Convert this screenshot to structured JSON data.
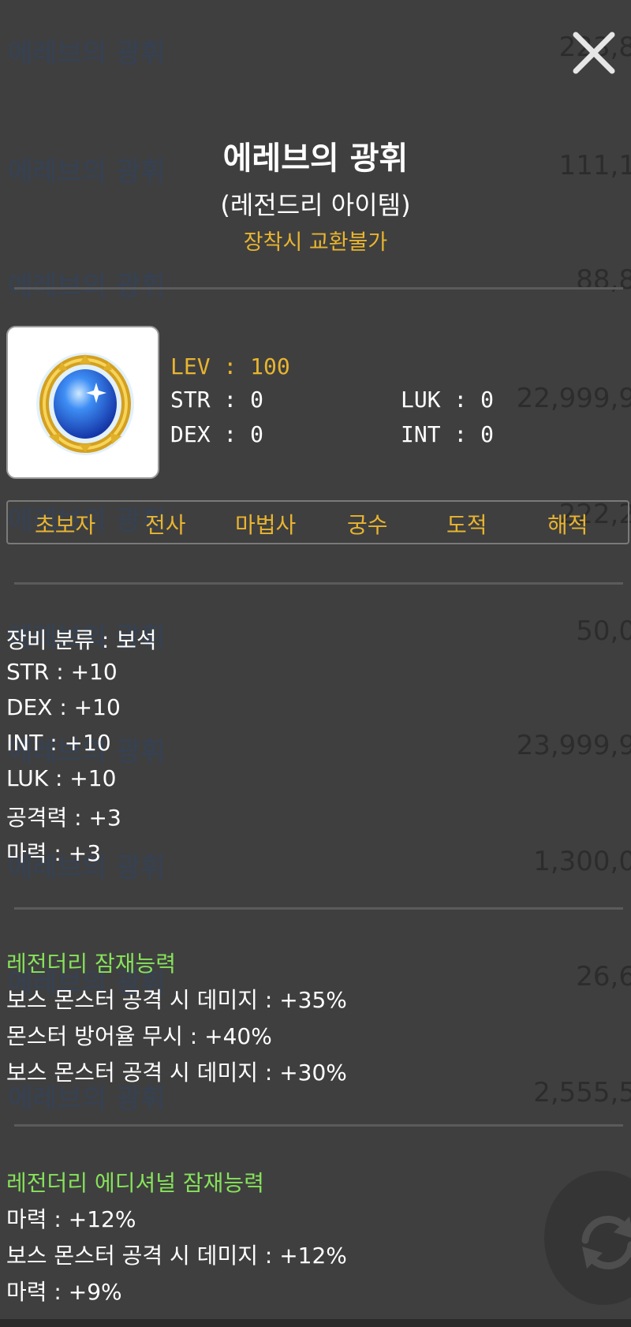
{
  "background_list": {
    "rows": [
      {
        "name": "에레브의 광휘",
        "price": "223,8"
      },
      {
        "name": "에레브의 광휘",
        "price": "111,1"
      },
      {
        "name": "에레브의 광휘",
        "price": "88,8"
      },
      {
        "name": "",
        "price": "22,999,9"
      },
      {
        "name": "에레브의 광휘",
        "price": "222,2"
      },
      {
        "name": "에레브의 광휘",
        "price": "50,0"
      },
      {
        "name": "에레브의 광휘",
        "price": "23,999,9"
      },
      {
        "name": "에레브의 광휘",
        "price": "1,300,0"
      },
      {
        "name": "에레브의 광휘",
        "price": "26,6"
      },
      {
        "name": "에레브의 광휘",
        "price": "2,555,5"
      }
    ]
  },
  "tooltip": {
    "title": "에레브의 광휘",
    "rarity": "(레전드리 아이템)",
    "trade_note": "장착시 교환불가",
    "item_icon": "blue-gem-brooch-icon",
    "requirements": {
      "lev": "LEV : 100",
      "str": "STR : 0",
      "luk": "LUK : 0",
      "dex": "DEX : 0",
      "int": "INT : 0"
    },
    "jobs": [
      "초보자",
      "전사",
      "마법사",
      "궁수",
      "도적",
      "해적"
    ],
    "stats": [
      "장비 분류 : 보석",
      "STR : +10",
      "DEX : +10",
      "INT : +10",
      "LUK : +10",
      "공격력 : +3",
      "마력 : +3"
    ],
    "potential": {
      "title": "레전더리 잠재능력",
      "lines": [
        "보스 몬스터 공격 시 데미지 : +35%",
        "몬스터 방어율 무시 : +40%",
        "보스 몬스터 공격 시 데미지 : +30%"
      ]
    },
    "additional_potential": {
      "title": "레전더리 에디셔널 잠재능력",
      "lines": [
        "마력 : +12%",
        "보스 몬스터 공격 시 데미지 : +12%",
        "마력 : +9%"
      ]
    }
  },
  "colors": {
    "background": "#3f3f3f",
    "gold": "#e8b430",
    "legendary_green": "#86e25a",
    "divider": "#5b5b5b"
  },
  "icons": {
    "close": "close-icon",
    "refresh": "refresh-icon"
  }
}
